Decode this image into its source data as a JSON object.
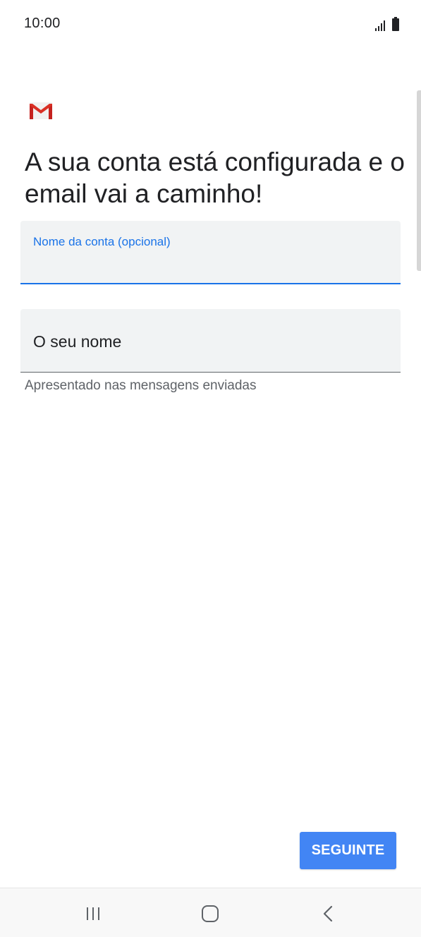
{
  "status_bar": {
    "time": "10:00",
    "icons": [
      "signal-icon",
      "battery-icon"
    ]
  },
  "app": {
    "logo": "gmail-logo-icon",
    "colors": {
      "accent": "#1a73e8",
      "button": "#4285f4",
      "gmail_red": "#d93025"
    }
  },
  "page": {
    "heading": "A sua conta está configurada e o email vai a caminho!"
  },
  "form": {
    "account_name": {
      "label": "Nome da conta (opcional)",
      "value": ""
    },
    "your_name": {
      "placeholder": "O seu nome",
      "value": "",
      "helper": "Apresentado nas mensagens enviadas"
    }
  },
  "actions": {
    "next_label": "SEGUINTE"
  },
  "nav_bar": {
    "buttons": [
      "recent-apps-icon",
      "home-icon",
      "back-icon"
    ]
  }
}
